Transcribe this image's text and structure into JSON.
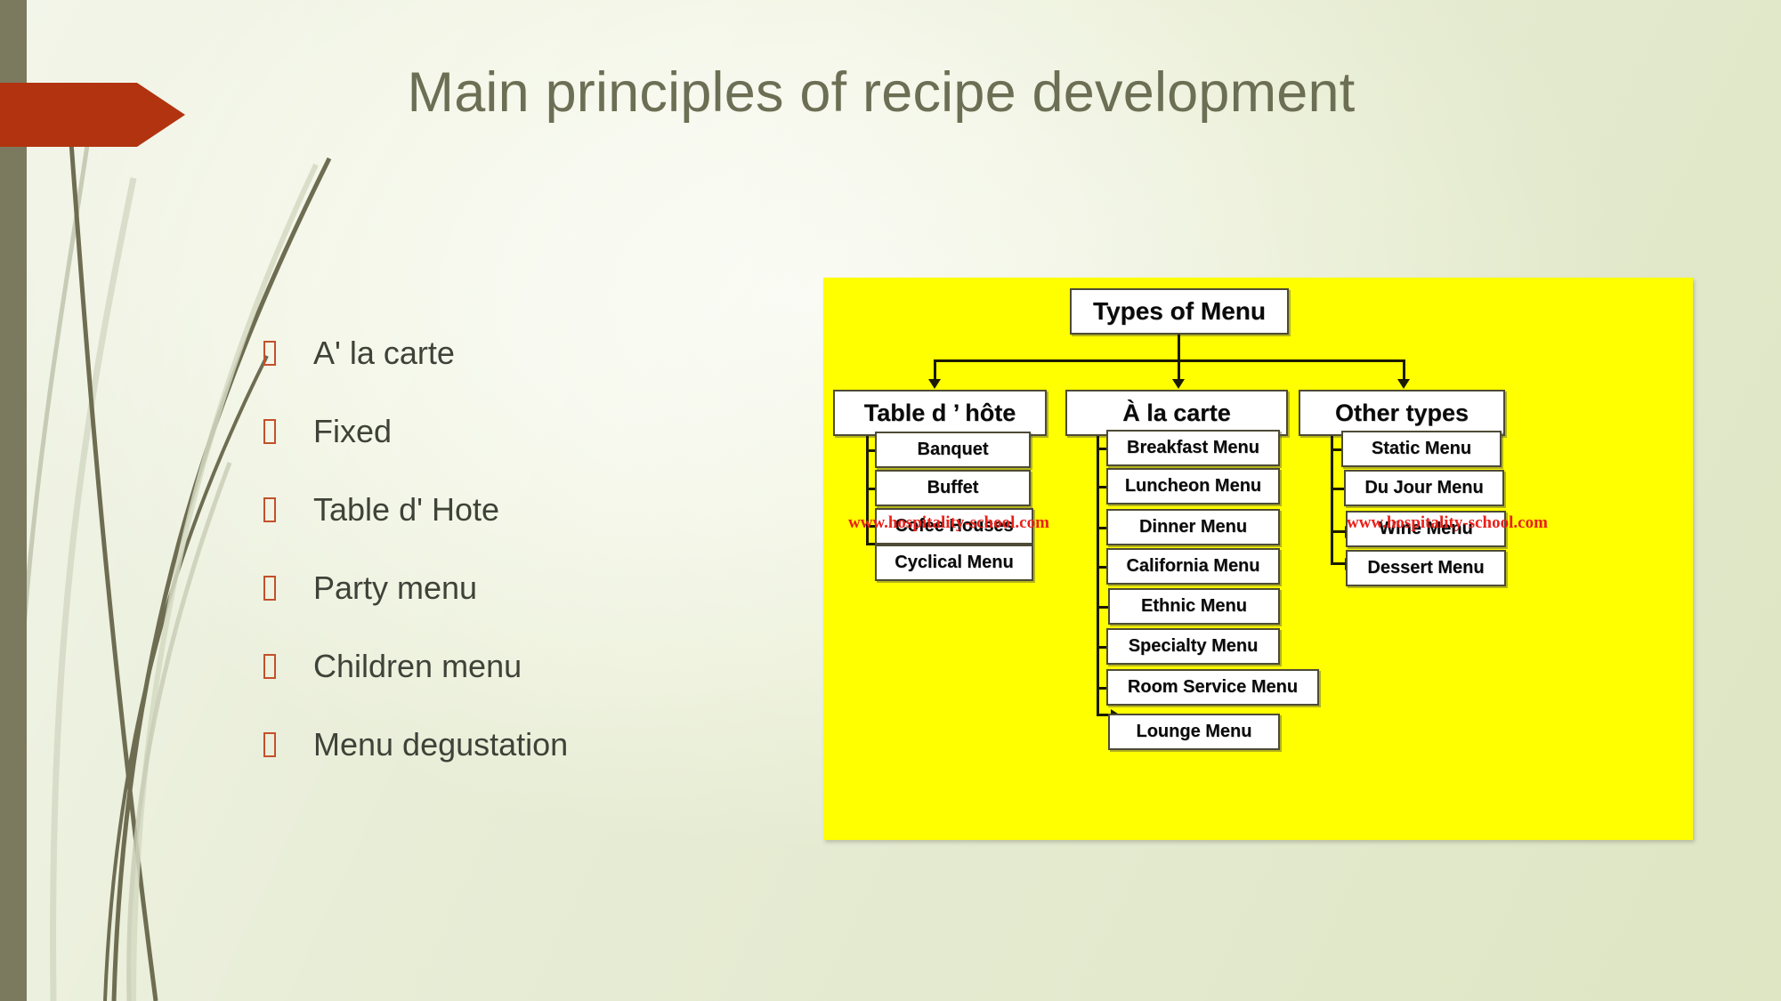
{
  "slide": {
    "title": "Main principles of recipe development",
    "background_accent": "#e4ead0",
    "title_color": "#6c6f54",
    "banner_color": "#b2330f",
    "left_bar_color": "#7c7a5e"
  },
  "bullets": [
    {
      "label": "A' la carte"
    },
    {
      "label": "Fixed"
    },
    {
      "label": "Table d' Hote"
    },
    {
      "label": "Party menu"
    },
    {
      "label": "Children menu"
    },
    {
      "label": "Menu degustation"
    }
  ],
  "diagram": {
    "background_color": "#ffff00",
    "root": "Types of Menu",
    "branches": [
      {
        "heading": "Table d ’ hôte",
        "items": [
          "Banquet",
          "Buffet",
          "Cofee Houses",
          "Cyclical Menu"
        ]
      },
      {
        "heading": "À la carte",
        "items": [
          "Breakfast Menu",
          "Luncheon Menu",
          "Dinner Menu",
          "California Menu",
          "Ethnic Menu",
          "Specialty Menu",
          "Room Service Menu",
          "Lounge Menu"
        ]
      },
      {
        "heading": "Other types",
        "items": [
          "Static Menu",
          "Du Jour Menu",
          "Wine Menu",
          "Dessert Menu"
        ]
      }
    ],
    "watermarks": [
      {
        "text": "www.hospitality-school.com"
      },
      {
        "text": "www.hospitality-school.com"
      }
    ],
    "watermark_color": "#e8211a"
  }
}
